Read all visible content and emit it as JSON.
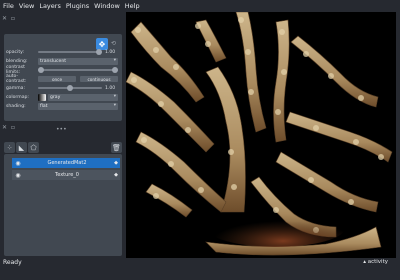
{
  "menubar": {
    "items": [
      "File",
      "View",
      "Layers",
      "Plugins",
      "Window",
      "Help"
    ]
  },
  "layer_controls": {
    "opacity": {
      "label": "opacity:",
      "value": "1.00",
      "fraction": 1.0
    },
    "blending": {
      "label": "blending:",
      "value": "translucent"
    },
    "contrast_limits": {
      "label": "contrast limits:"
    },
    "auto_contrast": {
      "label": "auto-contrast:",
      "once": "once",
      "continuous": "continuous"
    },
    "gamma": {
      "label": "gamma:",
      "value": "1.00",
      "fraction": 0.5
    },
    "colormap": {
      "label": "colormap:",
      "value": "gray"
    },
    "shading": {
      "label": "shading:",
      "value": "flat"
    }
  },
  "layers": [
    {
      "name": "GeneratedMat2",
      "selected": true
    },
    {
      "name": "Texture_0",
      "selected": false
    }
  ],
  "status": {
    "text": "Ready",
    "activity": "activity"
  },
  "icons": {
    "move": "move-arrows-icon",
    "rotate": "rotate-icon",
    "points": "new-points-icon",
    "shapes": "new-shapes-icon",
    "labels": "new-labels-icon",
    "delete": "trash-icon",
    "console": "console-icon",
    "ndisplay": "ndisplay-icon",
    "roll": "roll-icon",
    "transpose": "transpose-icon",
    "grid": "grid-icon",
    "home": "home-icon",
    "visibility": "eye-icon"
  },
  "colors": {
    "accent": "#3a8be0",
    "selected_layer": "#1f6fc2",
    "panel_bg": "#414851",
    "app_bg": "#262930"
  }
}
